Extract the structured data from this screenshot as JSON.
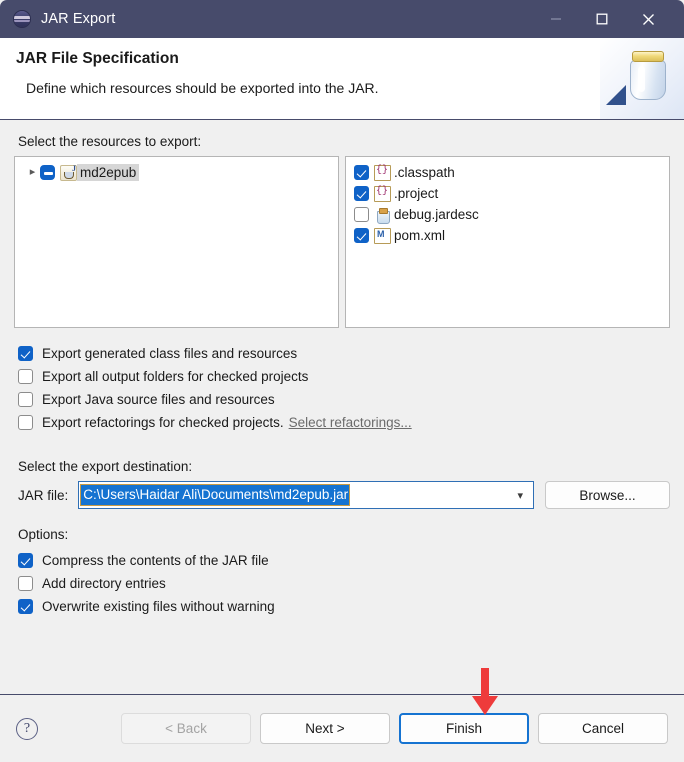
{
  "window": {
    "title": "JAR Export",
    "icon": "eclipse-icon",
    "controls": {
      "minimize": "minimize-icon",
      "maximize": "maximize-icon",
      "close": "close-icon"
    }
  },
  "header": {
    "title": "JAR File Specification",
    "subtitle": "Define which resources should be exported into the JAR.",
    "art_icon": "jar-banner-icon"
  },
  "resources": {
    "label": "Select the resources to export:",
    "tree": [
      {
        "label": "md2epub",
        "checkstate": "partial",
        "expander": "chevron-right-icon",
        "icon": "java-project-icon",
        "selected": true
      }
    ],
    "files": [
      {
        "label": ".classpath",
        "checked": true,
        "icon": "xml-file-icon"
      },
      {
        "label": ".project",
        "checked": true,
        "icon": "xml-file-icon"
      },
      {
        "label": "debug.jardesc",
        "checked": false,
        "icon": "jardesc-file-icon"
      },
      {
        "label": "pom.xml",
        "checked": true,
        "icon": "maven-pom-icon"
      }
    ]
  },
  "export_options": [
    {
      "label": "Export generated class files and resources",
      "checked": true
    },
    {
      "label": "Export all output folders for checked projects",
      "checked": false
    },
    {
      "label": "Export Java source files and resources",
      "checked": false
    },
    {
      "label": "Export refactorings for checked projects.",
      "checked": false,
      "link": "Select refactorings..."
    }
  ],
  "destination": {
    "label": "Select the export destination:",
    "jar_file_label": "JAR file:",
    "jar_file_value": "C:\\Users\\Haidar Ali\\Documents\\md2epub.jar",
    "dropdown_icon": "chevron-down-icon",
    "browse_label": "Browse..."
  },
  "options": {
    "label": "Options:",
    "items": [
      {
        "label": "Compress the contents of the JAR file",
        "checked": true
      },
      {
        "label": "Add directory entries",
        "checked": false
      },
      {
        "label": "Overwrite existing files without warning",
        "checked": true
      }
    ]
  },
  "footer": {
    "help_label": "?",
    "buttons": [
      {
        "label": "< Back",
        "state": "disabled"
      },
      {
        "label": "Next >",
        "state": "normal"
      },
      {
        "label": "Finish",
        "state": "focused"
      },
      {
        "label": "Cancel",
        "state": "normal"
      }
    ]
  },
  "annotation": {
    "arrow_color": "#ee3b3b",
    "points_to": "Finish"
  },
  "colors": {
    "titlebar": "#474b6b",
    "dialog_bg": "#f0f0f0",
    "accent_blue": "#1573d1",
    "selection_blue": "#1573d1",
    "checkbox_blue": "#0f62c7",
    "annotation_red": "#ee3b3b"
  }
}
